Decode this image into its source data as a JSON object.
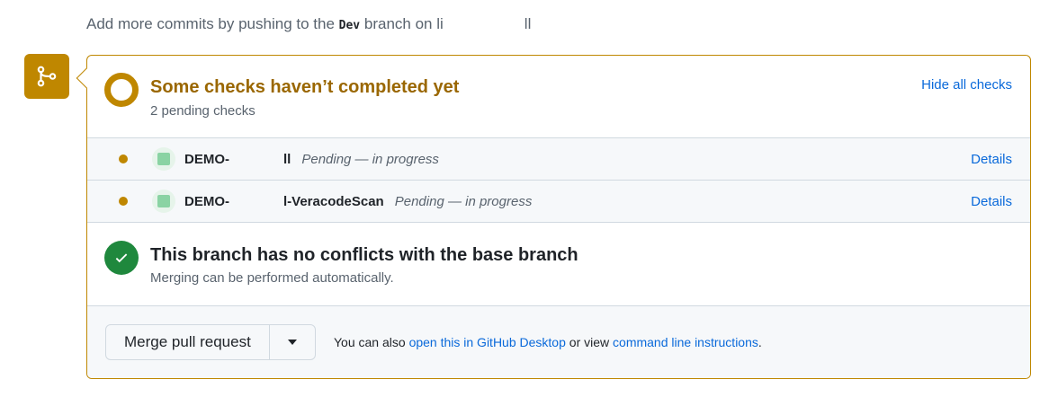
{
  "intro": {
    "prefix": "Add more commits by pushing to the",
    "branch": "Dev",
    "middle": "branch on",
    "repo_fragment": "li",
    "repo_suffix": "ll"
  },
  "checks": {
    "title": "Some checks haven’t completed yet",
    "subtitle": "2 pending checks",
    "hide_label": "Hide all checks",
    "items": [
      {
        "name_prefix": "DEMO-",
        "name_suffix": "ll",
        "status": "Pending — in progress",
        "details": "Details"
      },
      {
        "name_prefix": "DEMO-",
        "name_suffix": "l-VeracodeScan",
        "status": "Pending — in progress",
        "details": "Details"
      }
    ]
  },
  "conflicts": {
    "title": "This branch has no conflicts with the base branch",
    "subtitle": "Merging can be performed automatically."
  },
  "merge": {
    "button": "Merge pull request",
    "note_prefix": "You can also",
    "desktop_link": "open this in GitHub Desktop",
    "note_middle": "or view",
    "cli_link": "command line instructions",
    "note_suffix": "."
  },
  "colors": {
    "pending": "#bf8700",
    "success": "#1f883d",
    "link": "#0969da"
  }
}
